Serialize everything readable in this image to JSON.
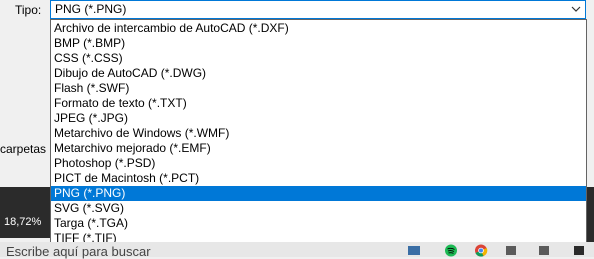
{
  "tipo_label": "Tipo:",
  "combo": {
    "selected": "PNG (*.PNG)"
  },
  "left_label": "carpetas",
  "zoom": "18,72%",
  "taskbar": {
    "search_placeholder": "Escribe aquí para buscar"
  },
  "options": [
    "Archivo de intercambio de AutoCAD (*.DXF)",
    "BMP (*.BMP)",
    "CSS (*.CSS)",
    "Dibujo de AutoCAD (*.DWG)",
    "Flash (*.SWF)",
    "Formato de texto (*.TXT)",
    "JPEG (*.JPG)",
    "Metarchivo de Windows (*.WMF)",
    "Metarchivo mejorado (*.EMF)",
    "Photoshop (*.PSD)",
    "PICT de Macintosh (*.PCT)",
    "PNG (*.PNG)",
    "SVG (*.SVG)",
    "Targa (*.TGA)",
    "TIFF (*.TIF)"
  ],
  "selected_index": 11,
  "colors": {
    "selection": "#0078d7",
    "border": "#0078d7"
  },
  "icons": [
    "chevron-down-icon",
    "spotify-icon",
    "chrome-icon"
  ]
}
